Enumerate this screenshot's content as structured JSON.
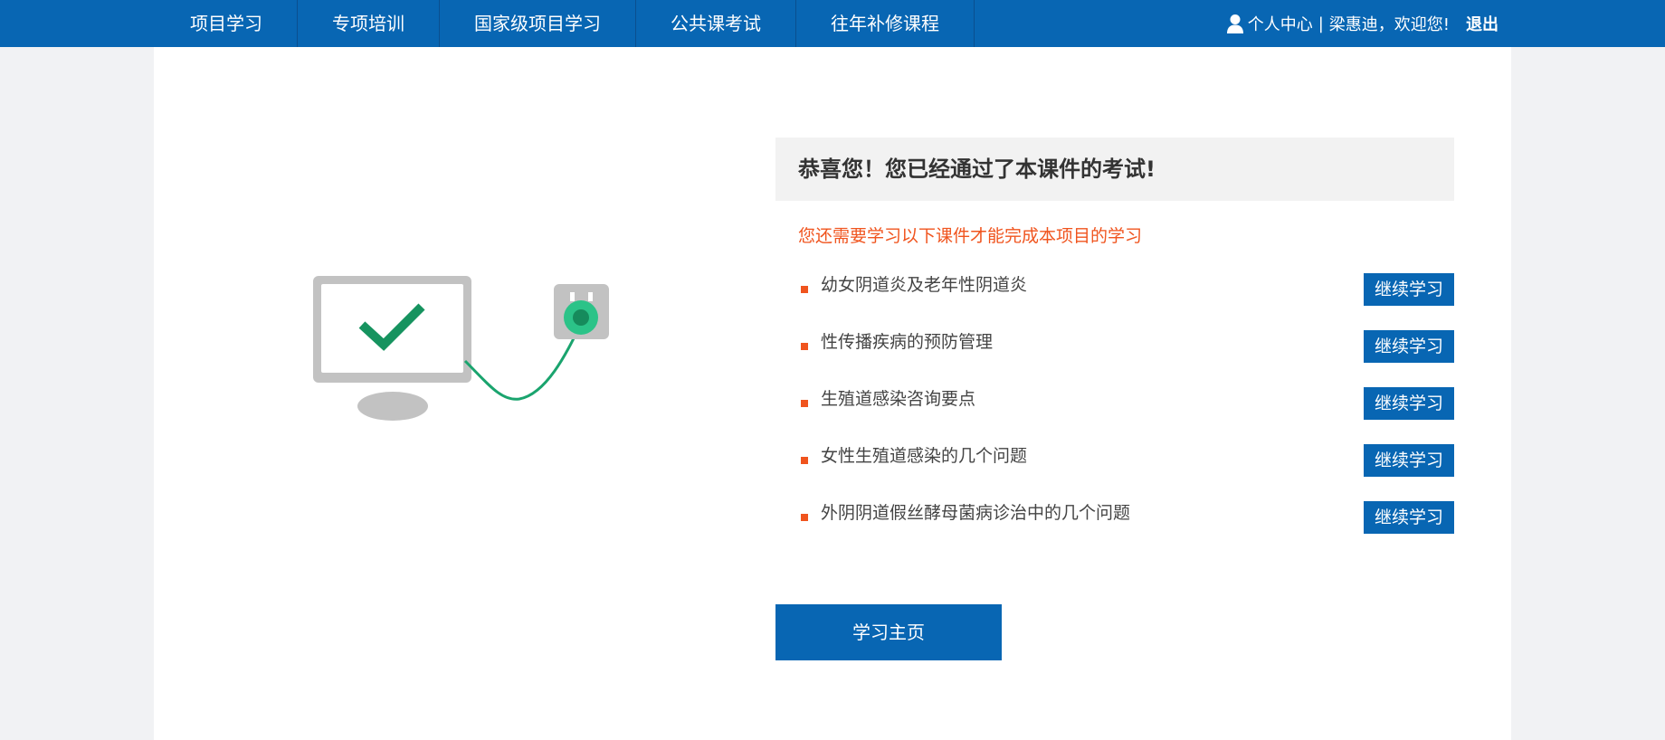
{
  "nav": {
    "items": [
      {
        "label": "项目学习"
      },
      {
        "label": "专项培训"
      },
      {
        "label": "国家级项目学习"
      },
      {
        "label": "公共课考试"
      },
      {
        "label": "往年补修课程"
      }
    ],
    "user": {
      "icon": "user-icon",
      "center_label": "个人中心",
      "separator": "|",
      "welcome": "梁惠迪，欢迎您!",
      "logout_label": "退出"
    }
  },
  "main": {
    "illustration": {
      "icon": "monitor-check-plug-icon",
      "accent_color": "#1aa46e"
    },
    "congrats_text": "恭喜您！您已经通过了本课件的考试!",
    "notice_text": "您还需要学习以下课件才能完成本项目的学习",
    "courses": [
      {
        "title": "幼女阴道炎及老年性阴道炎",
        "button": "继续学习"
      },
      {
        "title": "性传播疾病的预防管理",
        "button": "继续学习"
      },
      {
        "title": "生殖道感染咨询要点",
        "button": "继续学习"
      },
      {
        "title": "女性生殖道感染的几个问题",
        "button": "继续学习"
      },
      {
        "title": "外阴阴道假丝酵母菌病诊治中的几个问题",
        "button": "继续学习"
      }
    ],
    "home_button": "学习主页"
  },
  "colors": {
    "primary": "#0866b3",
    "accent": "#f0541e",
    "page_bg": "#f1f2f4"
  }
}
